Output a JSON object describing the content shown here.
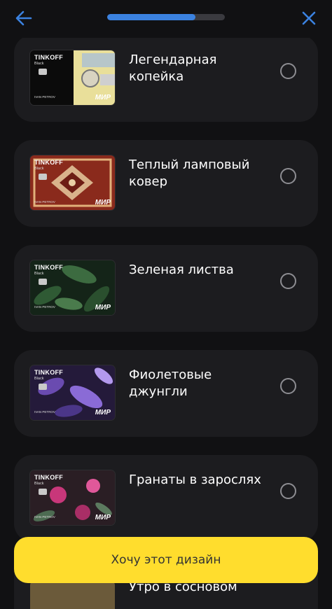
{
  "header": {
    "back_icon": "arrow-left-icon",
    "close_icon": "close-icon",
    "progress": 0.75,
    "accent": "#3b82e0"
  },
  "designs": [
    {
      "title": "Легендарная копейка",
      "brand": "TINKOFF",
      "tier": "Black",
      "holder": "IVAN PETROV",
      "network": "МИР",
      "theme": "kopeika"
    },
    {
      "title": "Теплый ламповый ковер",
      "brand": "TINKOFF",
      "tier": "Black",
      "holder": "IVAN PETROV",
      "network": "МИР",
      "theme": "carpet"
    },
    {
      "title": "Зеленая листва",
      "brand": "TINKOFF",
      "tier": "Black",
      "holder": "IVAN PETROV",
      "network": "МИР",
      "theme": "leaves"
    },
    {
      "title": "Фиолетовые джунгли",
      "brand": "TINKOFF",
      "tier": "Black",
      "holder": "IVAN PETROV",
      "network": "МИР",
      "theme": "violet"
    },
    {
      "title": "Гранаты в зарослях",
      "brand": "TINKOFF",
      "tier": "Black",
      "holder": "IVAN PETROV",
      "network": "МИР",
      "theme": "pomegranate"
    }
  ],
  "peek_item": {
    "title": "Утро в сосновом"
  },
  "cta": {
    "label": "Хочу этот дизайн",
    "color": "#ffdd2d"
  }
}
